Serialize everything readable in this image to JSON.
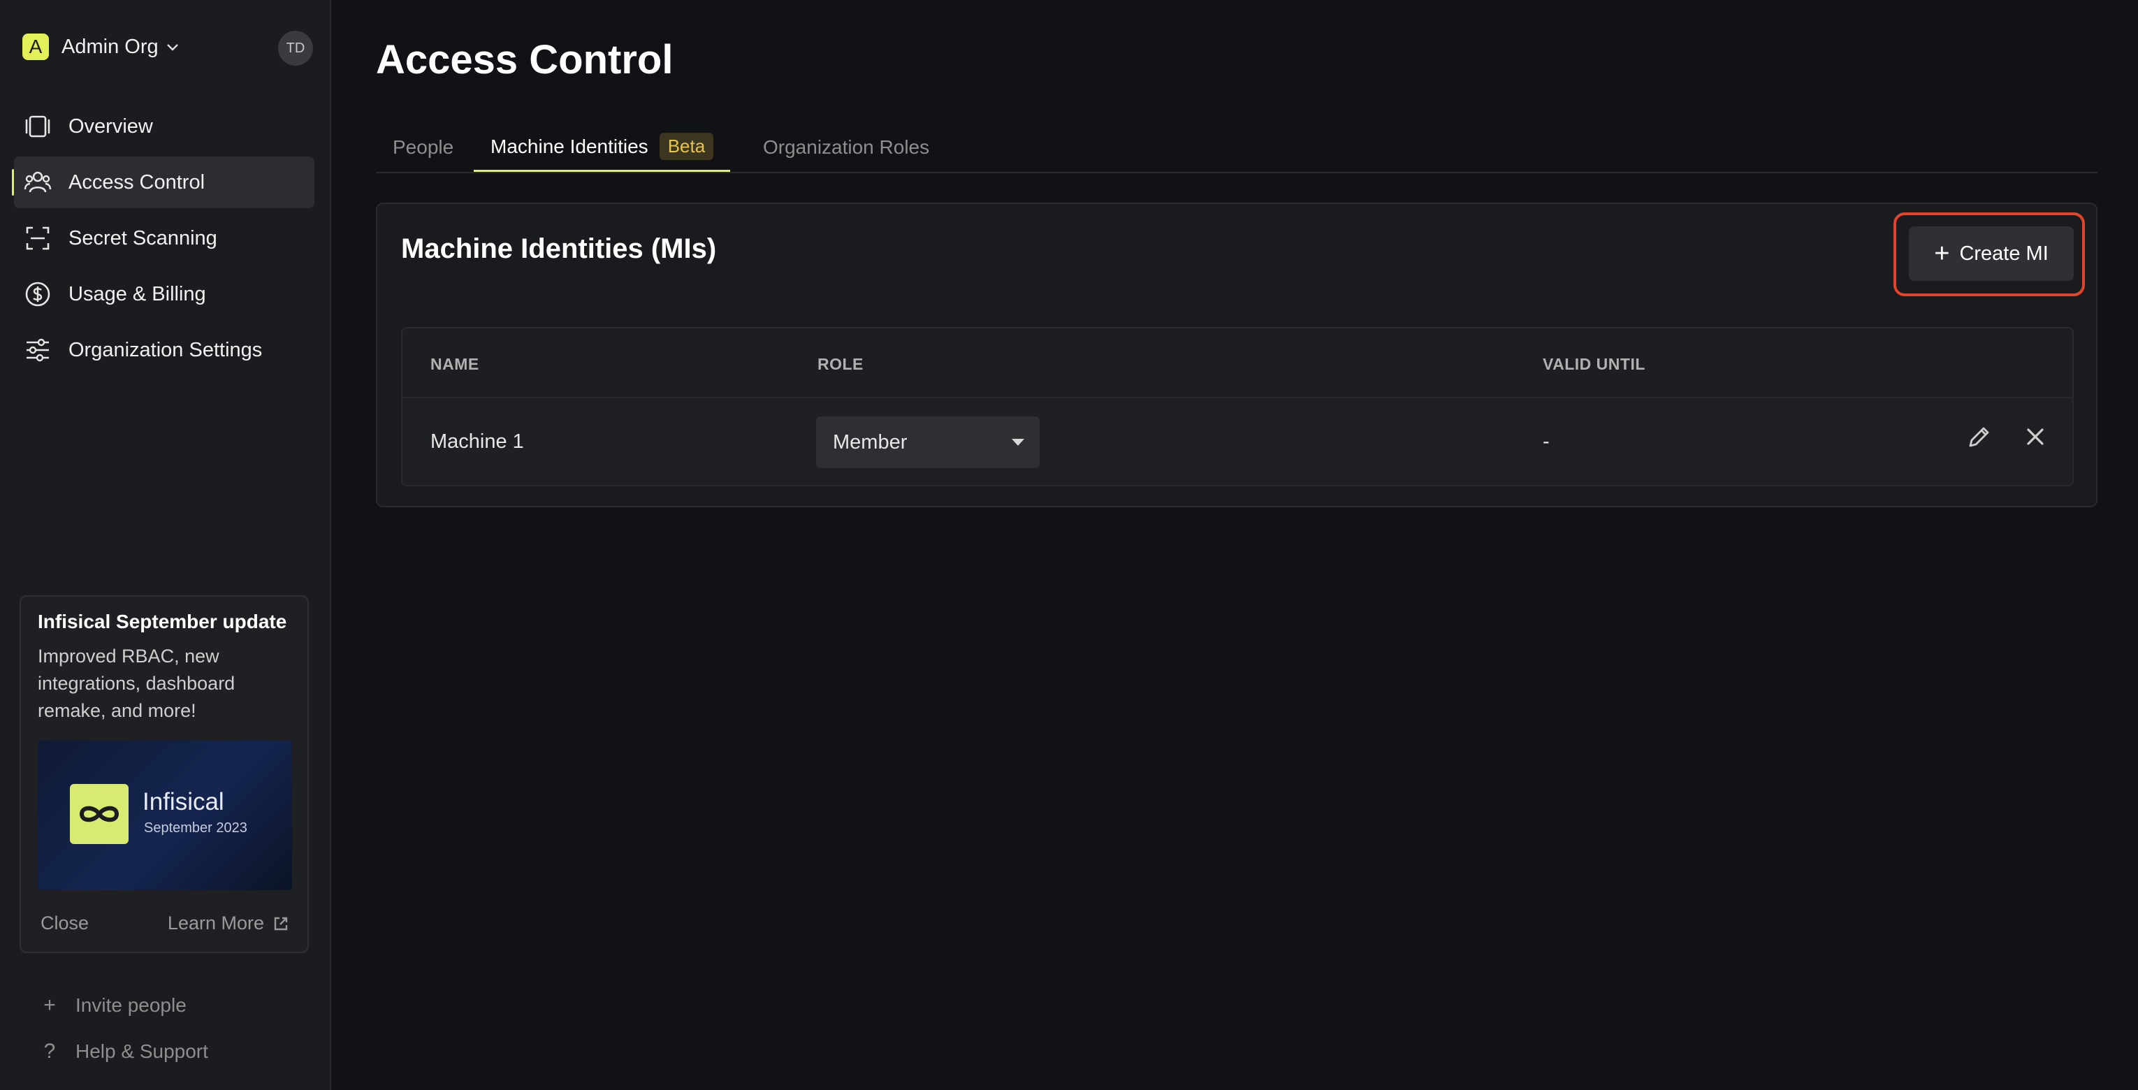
{
  "sidebar": {
    "org": {
      "initial": "A",
      "name": "Admin Org"
    },
    "avatar_initials": "TD",
    "nav": [
      {
        "label": "Overview",
        "icon": "overview-icon"
      },
      {
        "label": "Access Control",
        "icon": "users-icon",
        "active": true
      },
      {
        "label": "Secret Scanning",
        "icon": "scan-icon"
      },
      {
        "label": "Usage & Billing",
        "icon": "dollar-icon"
      },
      {
        "label": "Organization Settings",
        "icon": "sliders-icon"
      }
    ],
    "update_card": {
      "title": "Infisical September update",
      "body": "Improved RBAC, new integrations, dashboard remake, and more!",
      "banner_name": "Infisical",
      "banner_date": "September 2023",
      "close_label": "Close",
      "learn_more_label": "Learn More"
    },
    "invite_label": "Invite people",
    "help_label": "Help & Support"
  },
  "main": {
    "title": "Access Control",
    "tabs": [
      {
        "label": "People"
      },
      {
        "label": "Machine Identities",
        "badge": "Beta",
        "active": true
      },
      {
        "label": "Organization Roles"
      }
    ],
    "panel": {
      "title": "Machine Identities (MIs)",
      "create_label": "Create MI",
      "columns": [
        "NAME",
        "ROLE",
        "VALID UNTIL"
      ],
      "rows": [
        {
          "name": "Machine 1",
          "role": "Member",
          "valid_until": "-"
        }
      ]
    }
  },
  "colors": {
    "accent": "#e2f05a",
    "highlight": "#e2442c",
    "badge_text": "#e7c44c"
  }
}
